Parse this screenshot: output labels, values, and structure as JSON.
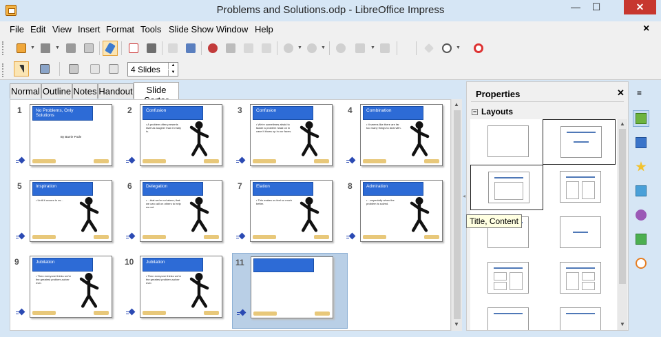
{
  "window": {
    "title": "Problems and Solutions.odp - LibreOffice Impress",
    "min_label": "—",
    "max_label": "☐",
    "close_label": "✕",
    "doc_close": "×"
  },
  "menu": [
    "File",
    "Edit",
    "View",
    "Insert",
    "Format",
    "Tools",
    "Slide Show",
    "Window",
    "Help"
  ],
  "toolbar": {
    "slides_spin_value": "4 Slides"
  },
  "view_tabs": [
    "Normal",
    "Outline",
    "Notes",
    "Handout",
    "Slide Sorter"
  ],
  "active_view_tab": "Slide Sorter",
  "slides": [
    {
      "num": "1",
      "title": "No Problems, Only Solutions",
      "sub": "By Barrie Pode",
      "text": ""
    },
    {
      "num": "2",
      "title": "Confusion",
      "text": "• A problem often presents itself as tougher than it really is."
    },
    {
      "num": "3",
      "title": "Confusion",
      "text": "• We're sometimes afraid to tackle a problem head on in case it blows up in our faces."
    },
    {
      "num": "4",
      "title": "Combination",
      "text": "• It seems like there are far too many things to deal with."
    },
    {
      "num": "5",
      "title": "Inspiration",
      "text": "• Until it occurs to us..."
    },
    {
      "num": "6",
      "title": "Delegation",
      "text": "• ...that we're not alone; that we can call on others to help us out."
    },
    {
      "num": "7",
      "title": "Elation",
      "text": "• This makes us feel so much better."
    },
    {
      "num": "8",
      "title": "Admiration",
      "text": "• ...especially when the problem is solved."
    },
    {
      "num": "9",
      "title": "Jubilation",
      "text": "• Then everyone thinks we're the greatest problem-solver ever."
    },
    {
      "num": "10",
      "title": "Jubilation",
      "text": "• Then everyone thinks we're the greatest problem-solver ever."
    },
    {
      "num": "11",
      "title": "",
      "text": ""
    }
  ],
  "properties": {
    "title": "Properties",
    "close_label": "✕",
    "section": "Layouts",
    "expander": "−",
    "tooltip": "Title, Content"
  },
  "deck": {
    "menu_label": "≡"
  },
  "colors": {
    "slide_title_bg": "#2d6bd6",
    "selection": "#b9cfe6",
    "close_red": "#c7372f",
    "layout_line": "#4f78b7"
  }
}
